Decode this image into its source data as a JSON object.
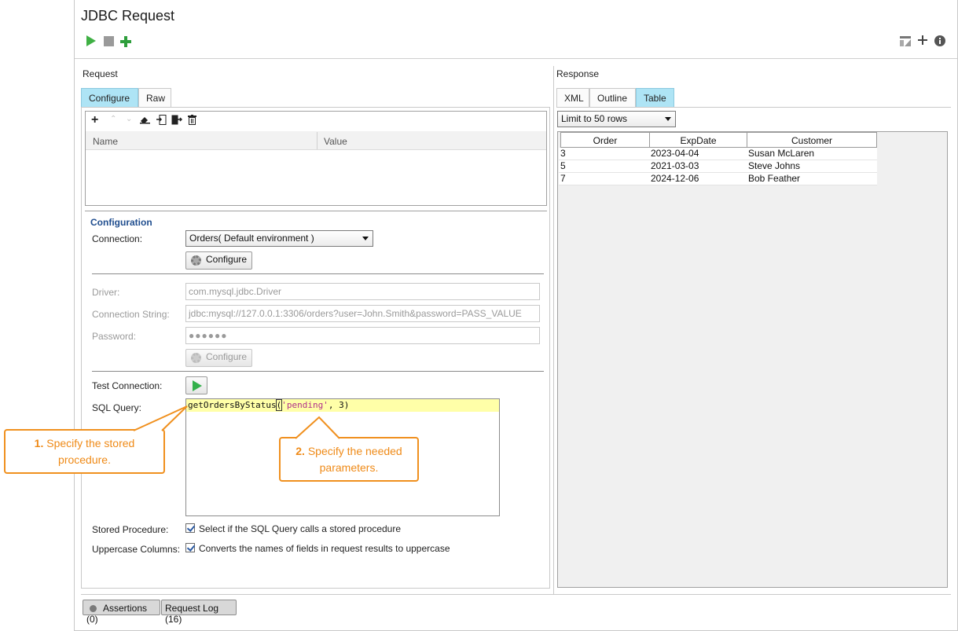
{
  "window": {
    "title": "JDBC Request"
  },
  "request": {
    "label": "Request",
    "tabs": [
      {
        "label": "Configure",
        "active": true
      },
      {
        "label": "Raw",
        "active": false
      }
    ],
    "grid": {
      "columns": [
        "Name",
        "Value"
      ]
    },
    "configuration": {
      "title": "Configuration",
      "connection_label": "Connection:",
      "connection_value": "Orders( Default environment )",
      "configure_button": "Configure",
      "driver_label": "Driver:",
      "driver_value": "com.mysql.jdbc.Driver",
      "conn_string_label": "Connection String:",
      "conn_string_value": "jdbc:mysql://127.0.0.1:3306/orders?user=John.Smith&password=PASS_VALUE",
      "password_label": "Password:",
      "password_value": "●●●●●●",
      "configure_button_disabled": "Configure",
      "test_connection_label": "Test Connection:",
      "sql_query_label": "SQL Query:",
      "sql_proc": "getOrdersByStatus",
      "sql_paren": "(",
      "sql_string": "'pending'",
      "sql_rest": ", 3)",
      "stored_proc_label": "Stored Procedure:",
      "stored_proc_text": "Select if the SQL Query calls a stored procedure",
      "stored_proc_checked": true,
      "uppercase_label": "Uppercase Columns:",
      "uppercase_text": "Converts the names of fields in request results to uppercase",
      "uppercase_checked": true
    }
  },
  "callouts": {
    "one_num": "1.",
    "one_text_a": "Specify the stored",
    "one_text_b": "procedure.",
    "two_num": "2.",
    "two_text_a": "Specify the needed",
    "two_text_b": "parameters."
  },
  "response": {
    "label": "Response",
    "tabs": [
      {
        "label": "XML",
        "active": false
      },
      {
        "label": "Outline",
        "active": false
      },
      {
        "label": "Table",
        "active": true
      }
    ],
    "limit_select": "Limit to 50 rows",
    "table": {
      "columns": [
        "Order",
        "ExpDate",
        "Customer"
      ],
      "rows": [
        [
          "3",
          "2023-04-04",
          "Susan McLaren"
        ],
        [
          "5",
          "2021-03-03",
          "Steve Johns"
        ],
        [
          "7",
          "2024-12-06",
          "Bob Feather"
        ]
      ]
    }
  },
  "bottom_tabs": {
    "assertions": "Assertions (0)",
    "request_log": "Request Log (16)"
  },
  "icons": {
    "run": "play-icon",
    "stop": "stop-icon",
    "add": "plus-icon",
    "settings": "layout-icon",
    "info": "info-icon"
  },
  "colors": {
    "accent_tab": "#aee4f5",
    "callout": "#f0901e",
    "run_green": "#3fb044"
  }
}
